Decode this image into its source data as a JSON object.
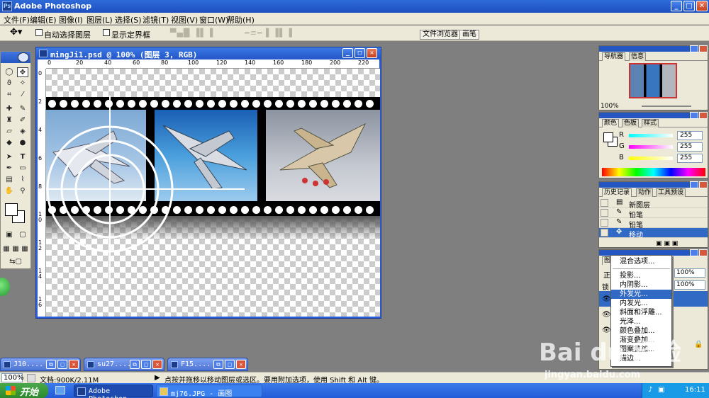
{
  "app": {
    "title": "Adobe Photoshop"
  },
  "menu": [
    "文件(F)",
    "编辑(E)",
    "图像(I)",
    "图层(L)",
    "选择(S)",
    "滤镜(T)",
    "视图(V)",
    "窗口(W)",
    "帮助(H)"
  ],
  "options": {
    "auto_select_label": "自动选择图层",
    "show_bbox_label": "显示定界框",
    "file_browser_tab": "文件浏览器",
    "brushes_tab": "画笔"
  },
  "document": {
    "title": "mingJi1.psd @ 100% (图层 3, RGB)",
    "ruler_top": [
      "0",
      "20",
      "40",
      "60",
      "80",
      "100",
      "120",
      "140",
      "160",
      "180",
      "200",
      "220"
    ],
    "ruler_left": [
      "0",
      "2",
      "4",
      "6",
      "8",
      "1 0",
      "1 2",
      "1 4",
      "1 6"
    ]
  },
  "minimized": [
    {
      "name": "J10...."
    },
    {
      "name": "su27...."
    },
    {
      "name": "F15...."
    }
  ],
  "status": {
    "zoom": "100%",
    "doc_info": "文档:900K/2.11M",
    "hint": "点按并拖移以移动图层或选区。要用附加选项，使用 Shift 和 Alt 键。"
  },
  "taskbar": {
    "start": "开始",
    "tasks": [
      "Adobe Photoshop",
      "mj76.JPG - 画图"
    ],
    "clock": "16:11"
  },
  "navigator": {
    "tabs": [
      "导航器",
      "信息"
    ],
    "zoom": "100%"
  },
  "color_palette": {
    "tabs": [
      "颜色",
      "色板",
      "样式"
    ],
    "channels": [
      {
        "label": "R",
        "value": "255"
      },
      {
        "label": "G",
        "value": "255"
      },
      {
        "label": "B",
        "value": "255"
      }
    ]
  },
  "history": {
    "tabs": [
      "历史记录",
      "动作",
      "工具预设"
    ],
    "items": [
      {
        "label": "新图层",
        "selected": false
      },
      {
        "label": "铅笔",
        "selected": false
      },
      {
        "label": "铅笔",
        "selected": false
      },
      {
        "label": "移动",
        "selected": true
      }
    ]
  },
  "layers": {
    "tab": "图",
    "blend_prefix": "正",
    "lock_prefix": "锁",
    "opacity": "100%",
    "fill": "100%"
  },
  "context_menu": {
    "items": [
      "混合选项...",
      "投影...",
      "内阴影...",
      "外发光...",
      "内发光...",
      "斜面和浮雕...",
      "光泽...",
      "颜色叠加...",
      "渐变叠加...",
      "图案叠加...",
      "描边..."
    ],
    "highlighted": "外发光..."
  },
  "watermark": {
    "brand": "Bai du 经验",
    "url": "jingyan.baidu.com"
  },
  "colors": {
    "title_blue": "#2456c2",
    "chrome": "#ece9d8",
    "workspace": "#7f7f7f",
    "highlight": "#316ac5"
  }
}
